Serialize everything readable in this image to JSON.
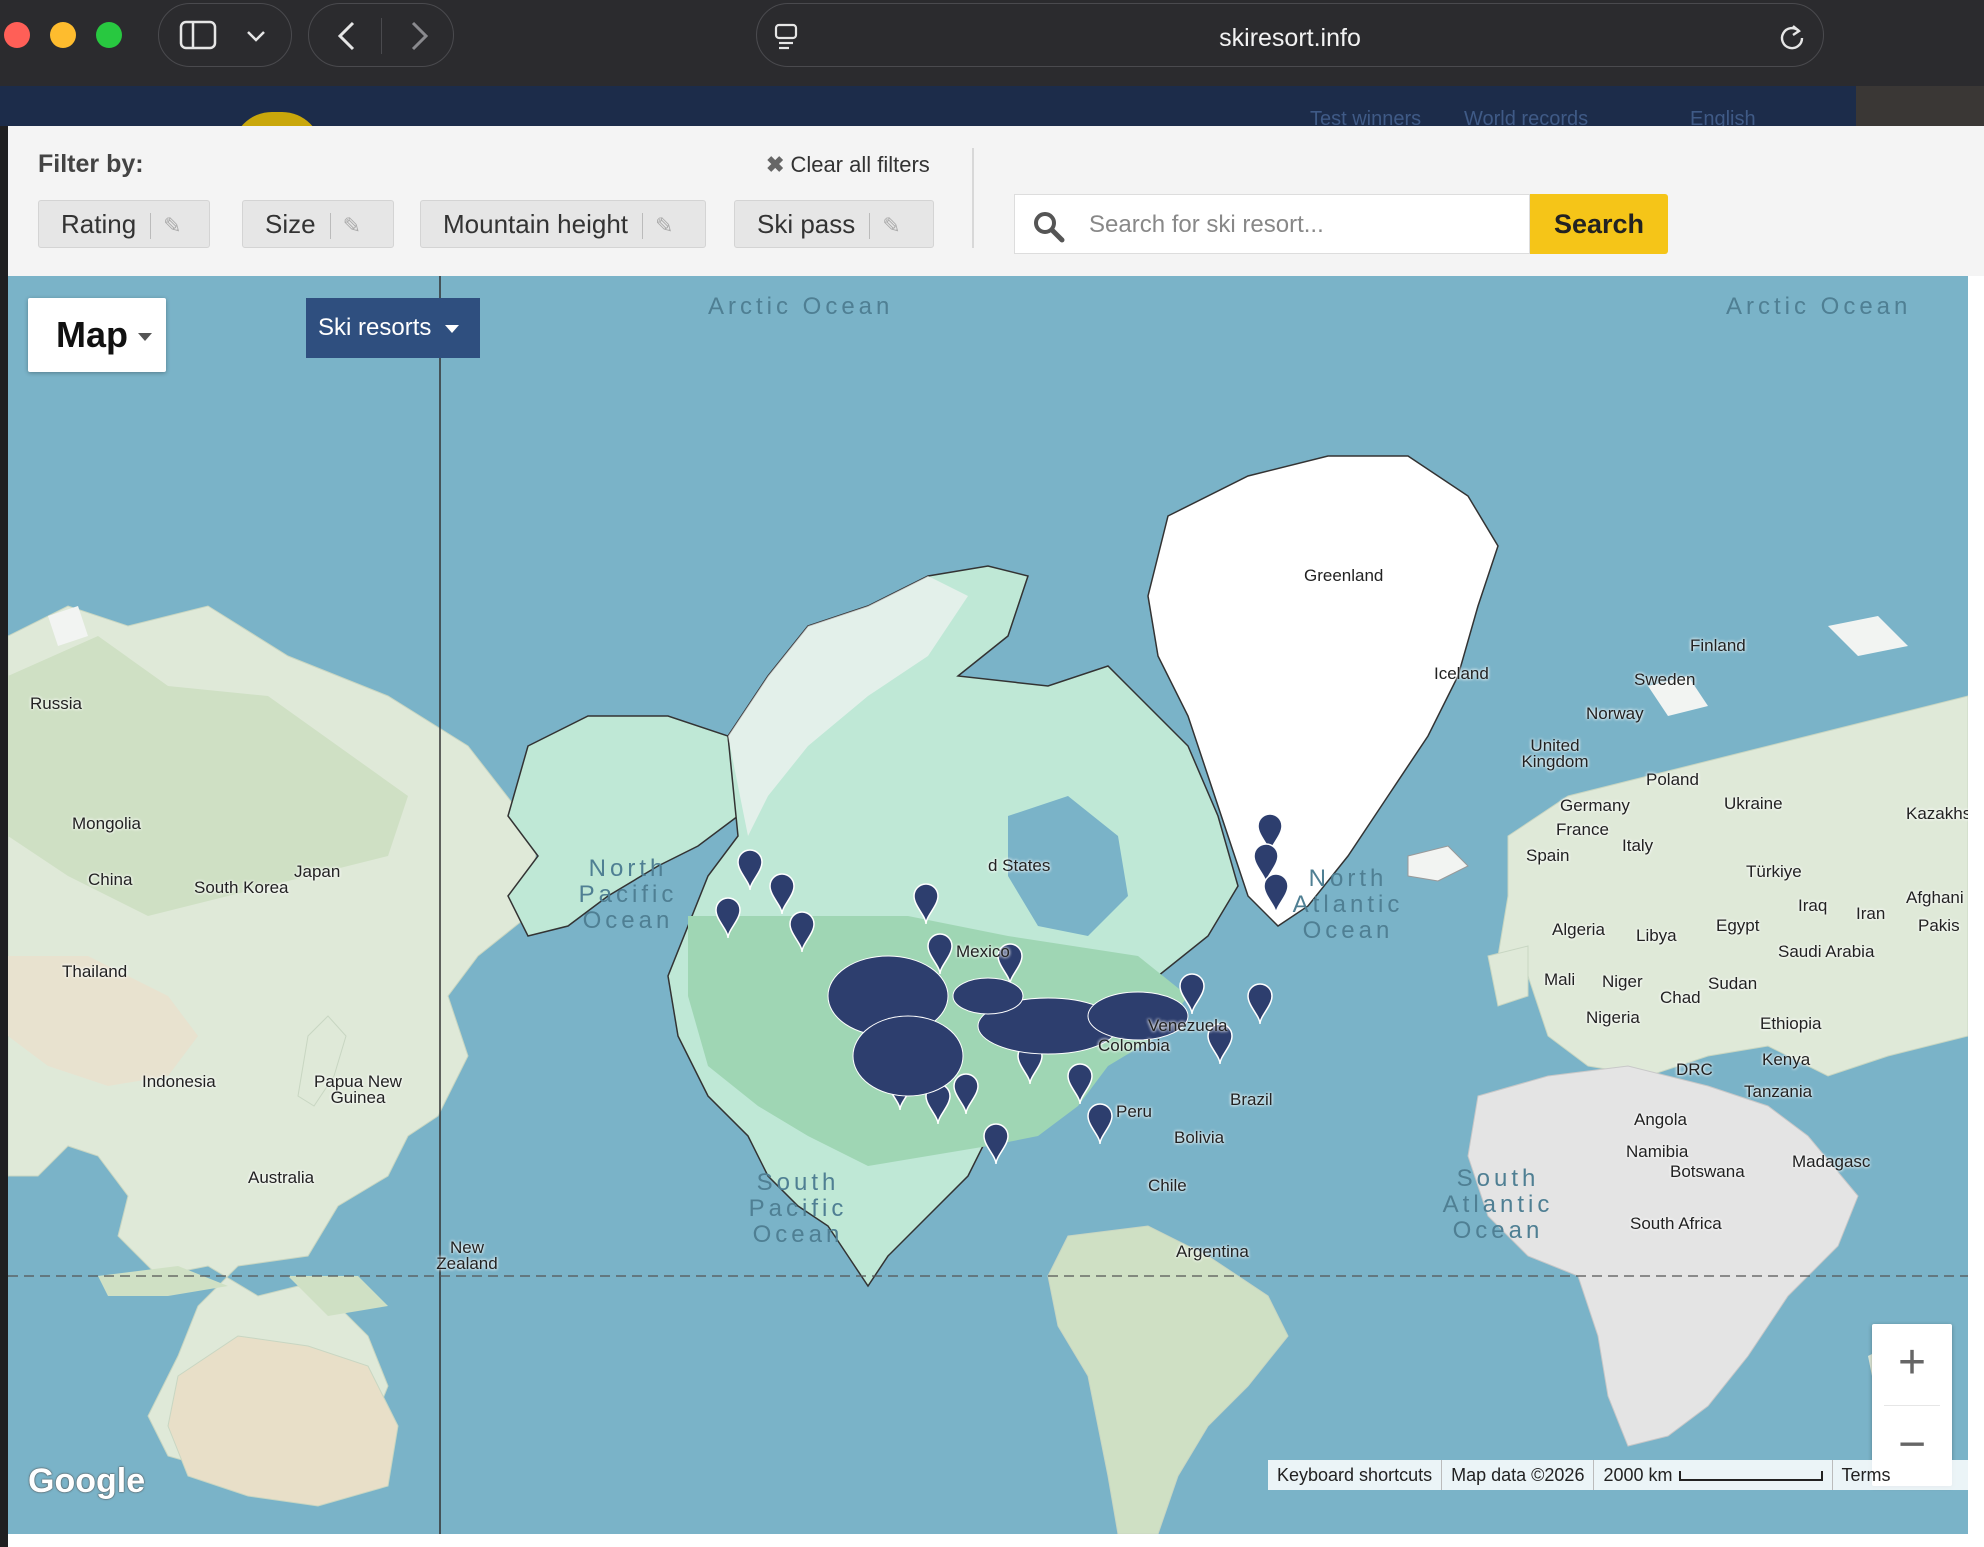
{
  "browser": {
    "url": "skiresort.info",
    "icons": [
      "sidebar-icon",
      "chevron-down-icon",
      "back-icon",
      "forward-icon",
      "tab-overview-icon",
      "reload-icon"
    ]
  },
  "background_page": {
    "links": [
      "Test winners",
      "World records",
      "English"
    ]
  },
  "filter": {
    "title": "Filter by:",
    "clear_label": "Clear all filters",
    "chips": [
      {
        "label": "Rating"
      },
      {
        "label": "Size"
      },
      {
        "label": "Mountain height"
      },
      {
        "label": "Ski pass"
      }
    ],
    "search_placeholder": "Search for ski resort...",
    "search_button": "Search"
  },
  "map": {
    "type_label": "Map",
    "layer_label": "Ski resorts",
    "zoom_in": "+",
    "zoom_out": "−",
    "logo": "Google",
    "oceans": {
      "arctic_1": "Arctic Ocean",
      "arctic_2": "Arctic Ocean",
      "north_pacific": "North Pacific Ocean",
      "north_atlantic": "North Atlantic Ocean",
      "south_pacific": "South Pacific Ocean",
      "south_atlantic": "South Atlantic Ocean"
    },
    "places": {
      "greenland": "Greenland",
      "iceland": "Iceland",
      "finland": "Finland",
      "sweden": "Sweden",
      "norway": "Norway",
      "uk": "United Kingdom",
      "poland": "Poland",
      "germany": "Germany",
      "ukraine": "Ukraine",
      "kazakhstan": "Kazakhs",
      "france": "France",
      "italy": "Italy",
      "spain": "Spain",
      "turkiye": "Türkiye",
      "iraq": "Iraq",
      "iran": "Iran",
      "afghanistan": "Afghani",
      "pakistan": "Pakis",
      "algeria": "Algeria",
      "libya": "Libya",
      "egypt": "Egypt",
      "saudi": "Saudi Arabia",
      "mali": "Mali",
      "niger": "Niger",
      "sudan": "Sudan",
      "chad": "Chad",
      "nigeria": "Nigeria",
      "ethiopia": "Ethiopia",
      "kenya": "Kenya",
      "drc": "DRC",
      "tanzania": "Tanzania",
      "angola": "Angola",
      "namibia": "Namibia",
      "botswana": "Botswana",
      "madagascar": "Madagasc",
      "south_africa": "South Africa",
      "russia": "Russia",
      "mongolia": "Mongolia",
      "china": "China",
      "south_korea": "South Korea",
      "japan": "Japan",
      "thailand": "Thailand",
      "indonesia": "Indonesia",
      "png": "Papua New Guinea",
      "australia": "Australia",
      "new_zealand": "New Zealand",
      "us": "d States",
      "mexico": "Mexico",
      "venezuela": "Venezuela",
      "colombia": "Colombia",
      "peru": "Peru",
      "brazil": "Brazil",
      "bolivia": "Bolivia",
      "chile": "Chile",
      "argentina": "Argentina"
    },
    "attribution": {
      "shortcuts": "Keyboard shortcuts",
      "data": "Map data ©2026",
      "scale": "2000 km",
      "terms": "Terms"
    },
    "colors": {
      "water": "#7ab3c8",
      "land": "#dfe9d8",
      "highlight": "#bfe8d6",
      "marker": "#2d3e6e"
    }
  }
}
